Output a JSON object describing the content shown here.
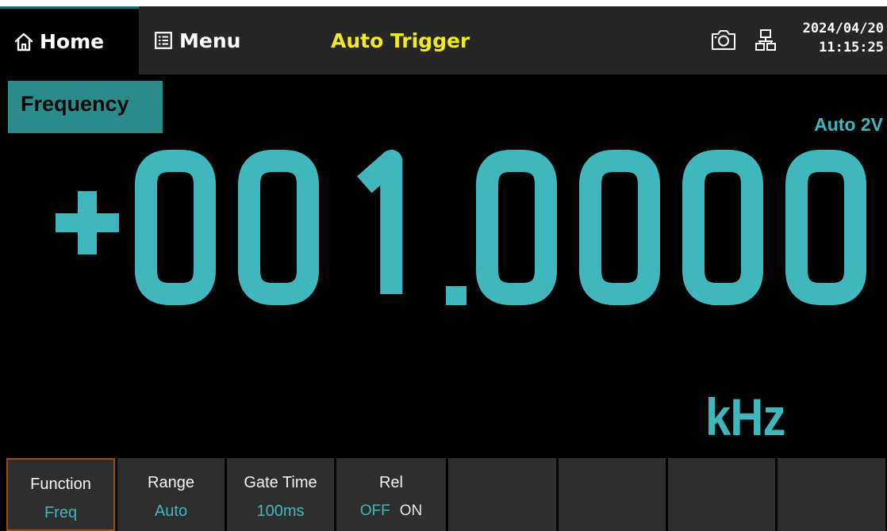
{
  "topbar": {
    "home_label": "Home",
    "menu_label": "Menu",
    "trigger_mode": "Auto Trigger",
    "date": "2024/04/20",
    "time": "11:15:25"
  },
  "measurement": {
    "function_label": "Frequency",
    "range_label": "Auto 2V",
    "reading": "+001.0000",
    "unit": "kHz"
  },
  "softkeys": [
    {
      "title": "Function",
      "value": "Freq",
      "selected": true
    },
    {
      "title": "Range",
      "value": "Auto"
    },
    {
      "title": "Gate Time",
      "value": "100ms"
    },
    {
      "title": "Rel",
      "off_label": "OFF",
      "on_label": "ON",
      "state": "OFF"
    },
    {
      "title": "",
      "value": ""
    },
    {
      "title": "",
      "value": ""
    },
    {
      "title": "",
      "value": ""
    },
    {
      "title": "",
      "value": ""
    }
  ],
  "colors": {
    "accent": "#3fb7bd",
    "badge": "#2b8a8a",
    "trigger": "#f2ea1f",
    "background": "#000000",
    "softkey": "#2e2e2e",
    "selected_border": "#9b4a10"
  },
  "icons": {
    "home": "home-icon",
    "menu": "menu-list-icon",
    "camera": "camera-icon",
    "network": "network-icon"
  }
}
